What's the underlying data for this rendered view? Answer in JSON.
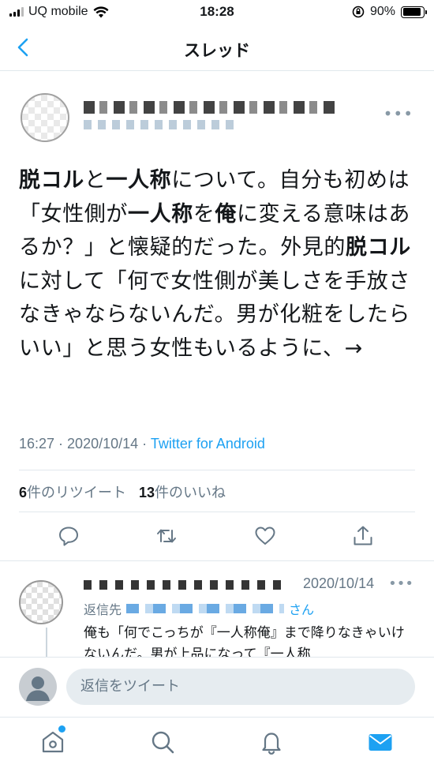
{
  "status_bar": {
    "carrier": "UQ mobile",
    "time": "18:28",
    "battery_percent": "90%",
    "battery_level": 0.9
  },
  "nav": {
    "title": "スレッド",
    "back_icon": "chevron-left-icon"
  },
  "tweet": {
    "text_segments": [
      {
        "t": "脱コル",
        "bold": true
      },
      {
        "t": "と",
        "bold": false
      },
      {
        "t": "一人称",
        "bold": true
      },
      {
        "t": "について。自分も初めは「女性側が",
        "bold": false
      },
      {
        "t": "一人称",
        "bold": true
      },
      {
        "t": "を",
        "bold": false
      },
      {
        "t": "俺",
        "bold": true
      },
      {
        "t": "に変える意味はあるか？」と懐疑的だった。外見的",
        "bold": false
      },
      {
        "t": "脱コル",
        "bold": true
      },
      {
        "t": "に対して「何で女性側が美しさを手放さなきゃならないんだ。男が化粧をしたらいい」と思う女性もいるように、→",
        "bold": false
      }
    ],
    "time": "16:27",
    "date": "2020/10/14",
    "separator": " · ",
    "source": "Twitter for Android",
    "retweet_count": "6",
    "retweet_label": "件のリツイート",
    "like_count": "13",
    "like_label": "件のいいね",
    "actions": [
      "reply-icon",
      "retweet-icon",
      "like-icon",
      "share-icon"
    ]
  },
  "reply": {
    "date": "2020/10/14",
    "reply_to_prefix": "返信先",
    "reply_to_suffix": "さん",
    "text": "俺も「何でこっちが『一人称俺』まで降りなきゃいけないんだ。男が上品になって『一人称"
  },
  "composer": {
    "placeholder": "返信をツイート"
  },
  "tab_bar": {
    "tabs": [
      "home-icon",
      "search-icon",
      "notifications-icon",
      "messages-icon"
    ],
    "active": "messages-icon"
  },
  "colors": {
    "accent": "#1da1f2",
    "secondary_text": "#657786",
    "border": "#e1e8ed"
  }
}
